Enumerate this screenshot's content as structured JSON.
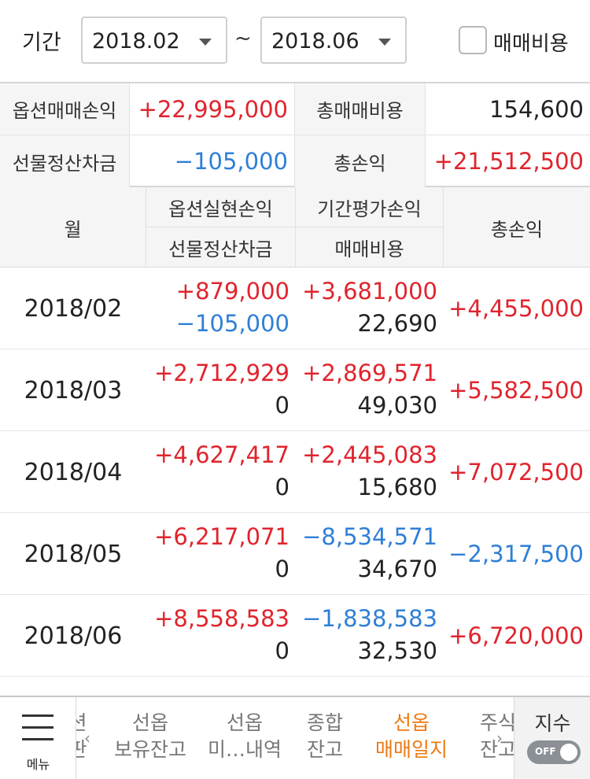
{
  "filter": {
    "label": "기간",
    "from": "2018.02",
    "to": "2018.06",
    "separator": "~",
    "fee_checkbox_label": "매매비용",
    "fee_checked": false
  },
  "summary": {
    "option_pl_label": "옵션매매손익",
    "option_pl": "+22,995,000",
    "total_fee_label": "총매매비용",
    "total_fee": "154,600",
    "futures_settle_label": "선물정산차금",
    "futures_settle": "−105,000",
    "total_pl_label": "총손익",
    "total_pl": "+21,512,500"
  },
  "table": {
    "headers": {
      "month": "월",
      "option_realized": "옵션실현손익",
      "futures_settle": "선물정산차금",
      "period_eval": "기간평가손익",
      "fee": "매매비용",
      "total": "총손익"
    },
    "rows": [
      {
        "month": "2018/02",
        "option_realized": "+879,000",
        "futures_settle": "−105,000",
        "period_eval": "+3,681,000",
        "fee": "22,690",
        "total": "+4,455,000"
      },
      {
        "month": "2018/03",
        "option_realized": "+2,712,929",
        "futures_settle": "0",
        "period_eval": "+2,869,571",
        "fee": "49,030",
        "total": "+5,582,500"
      },
      {
        "month": "2018/04",
        "option_realized": "+4,627,417",
        "futures_settle": "0",
        "period_eval": "+2,445,083",
        "fee": "15,680",
        "total": "+7,072,500"
      },
      {
        "month": "2018/05",
        "option_realized": "+6,217,071",
        "futures_settle": "0",
        "period_eval": "−8,534,571",
        "fee": "34,670",
        "total": "−2,317,500"
      },
      {
        "month": "2018/06",
        "option_realized": "+8,558,583",
        "futures_settle": "0",
        "period_eval": "−1,838,583",
        "fee": "32,530",
        "total": "+6,720,000"
      }
    ]
  },
  "nav": {
    "menu_label": "메뉴",
    "tabs": [
      {
        "line1": "션",
        "line2": "판"
      },
      {
        "line1": "선옵",
        "line2": "보유잔고"
      },
      {
        "line1": "선옵",
        "line2": "미…내역"
      },
      {
        "line1": "종합",
        "line2": "잔고"
      },
      {
        "line1": "선옵",
        "line2": "매매일지"
      },
      {
        "line1": "주식",
        "line2": "잔고"
      }
    ],
    "active_tab": 4,
    "index_label": "지수",
    "toggle_label": "OFF"
  },
  "colors": {
    "positive": "#e0242d",
    "negative": "#2f7fd6",
    "active_tab": "#ee7a12"
  }
}
